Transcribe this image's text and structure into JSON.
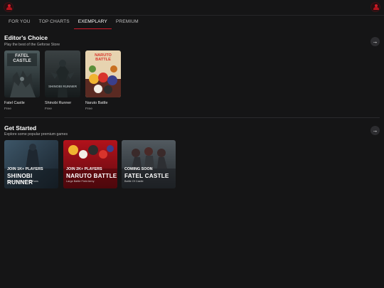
{
  "tabs": [
    "FOR YOU",
    "TOP CHARTS",
    "EXEMPLARY",
    "PREMIUM"
  ],
  "active_tab": "EXEMPLARY",
  "editors_choice": {
    "title": "Editor's Choice",
    "subtitle": "Play the best of the Geforse Store",
    "arrow": "→",
    "games": [
      {
        "name": "Fatel Castle",
        "price": "Free",
        "cover_text": "FATEL CASTLE"
      },
      {
        "name": "Shinobi Runner",
        "price": "Free",
        "cover_text": "SHINOBI RUNNER"
      },
      {
        "name": "Naruto Battle",
        "price": "Free",
        "cover_text": "NARUTO BATTLE"
      }
    ]
  },
  "get_started": {
    "title": "Get Started",
    "subtitle": "Explore some popular premium games",
    "arrow": "→",
    "promos": [
      {
        "kicker": "JOIN 1K+ PLAYERS",
        "title": "SHINOBI RUNNER",
        "desc": "Large Shallows Run Runs"
      },
      {
        "kicker": "JOIN 2K+ PLAYERS",
        "title": "NARUTO BATTLE",
        "desc": "Large Battle Field Army"
      },
      {
        "kicker": "COMING SOON",
        "title": "FATEL CASTLE",
        "desc": "Battle Of Castle"
      }
    ]
  },
  "colors": {
    "background": "#151516",
    "accent": "#d11a2a",
    "text": "#ffffff",
    "muted": "#b5b5b5"
  },
  "icons": {
    "logo": "user-logo-icon",
    "avatar": "user-avatar-icon",
    "arrow": "arrow-right-icon"
  }
}
